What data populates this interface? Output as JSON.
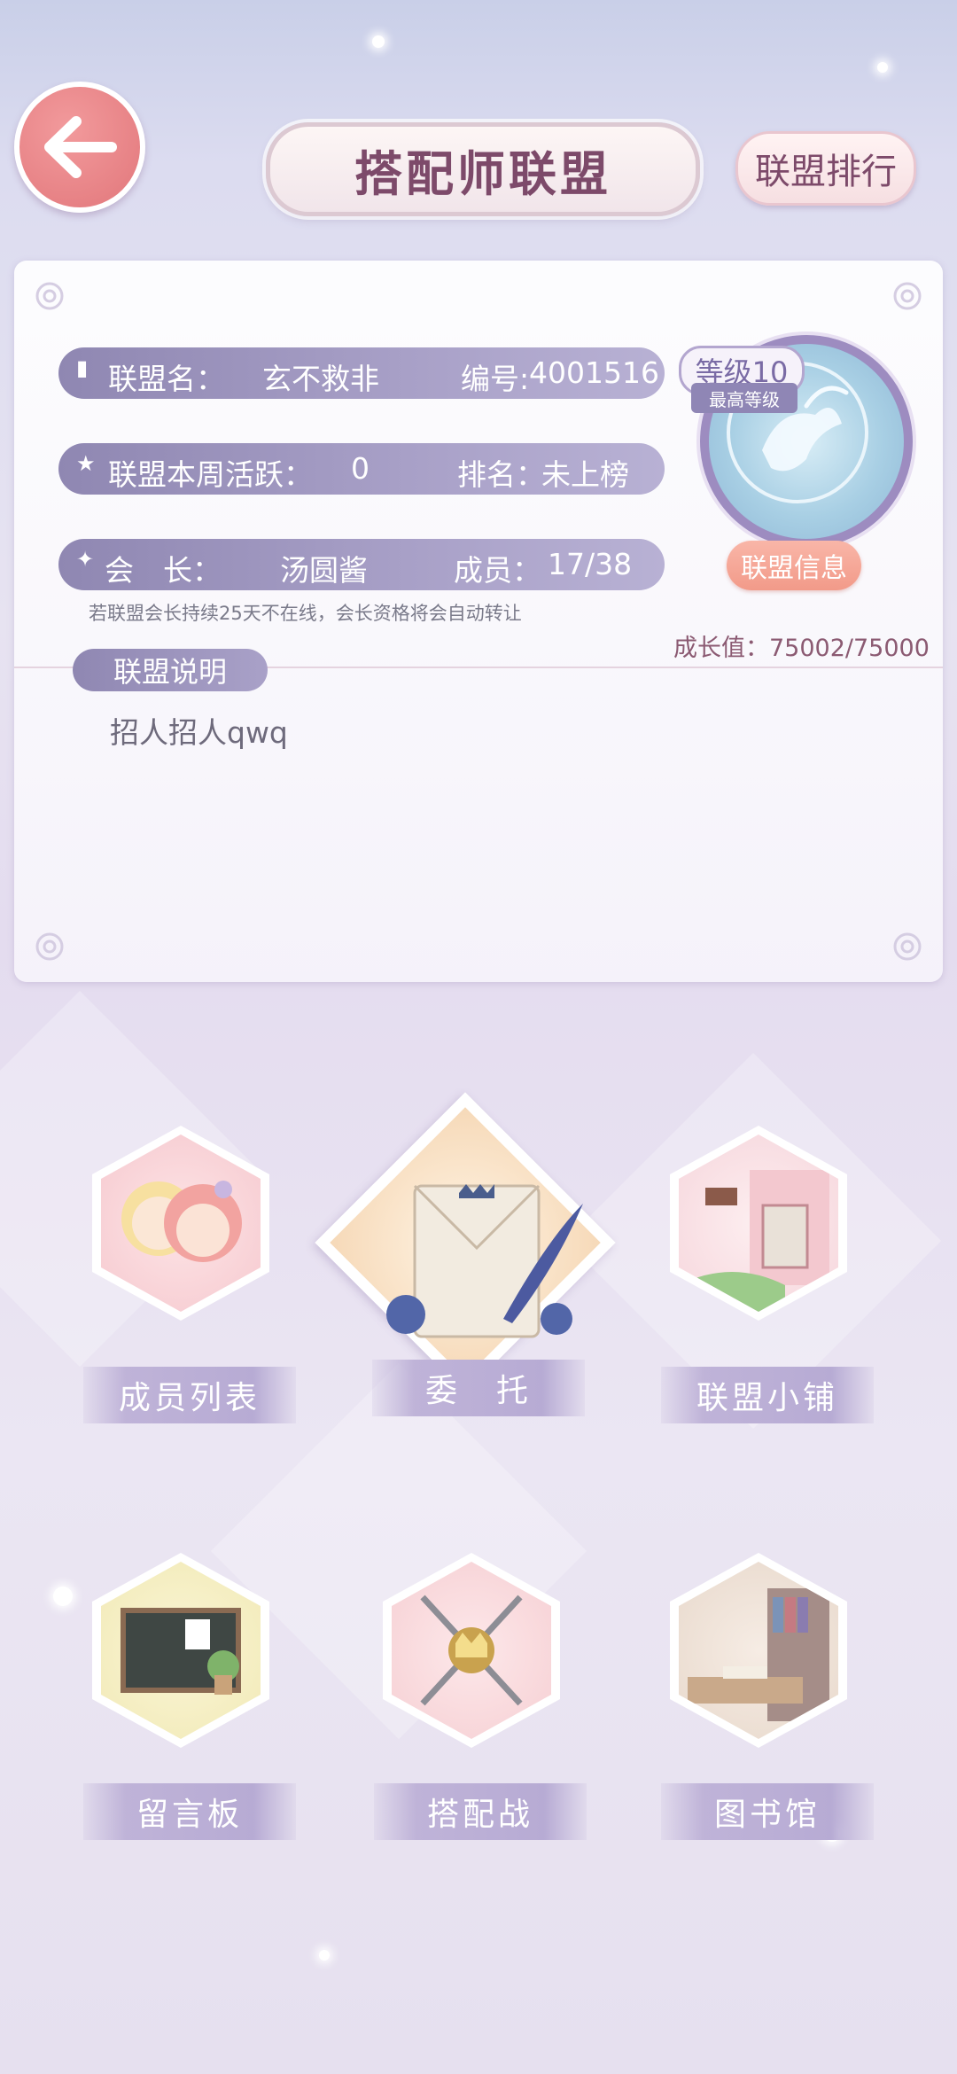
{
  "header": {
    "title": "搭配师联盟",
    "rank_button": "联盟排行"
  },
  "alliance": {
    "name_label": "联盟名：",
    "name_value": "玄不救非",
    "id_label": "编号:",
    "id_value": "4001516",
    "activity_label": "联盟本周活跃：",
    "activity_value": "0",
    "rank_label": "排名：",
    "rank_value": "未上榜",
    "leader_label": "会　长：",
    "leader_value": "汤圆酱",
    "members_label": "成员：",
    "members_value": "17/38",
    "leader_hint": "若联盟会长持续25天不在线，会长资格将会自动转让",
    "level": "等级10",
    "max_level": "最高等级",
    "info_button": "联盟信息",
    "growth": "成长值：75002/75000"
  },
  "description": {
    "label": "联盟说明",
    "text": "招人招人qwq"
  },
  "menu": {
    "members": "成员列表",
    "commission": "委　托",
    "shop": "联盟小铺",
    "board": "留言板",
    "battle": "搭配战",
    "library": "图书馆"
  }
}
